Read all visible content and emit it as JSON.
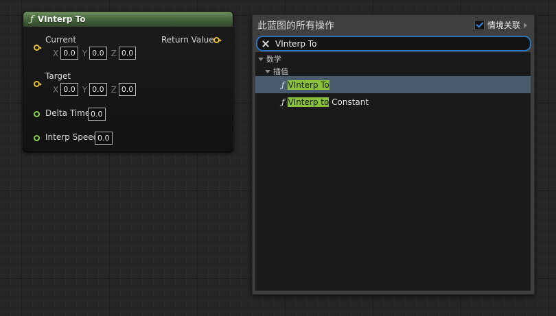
{
  "node": {
    "icon": "function-icon",
    "title": "VInterp To",
    "pins": {
      "current": {
        "label": "Current",
        "x_axis": "X",
        "x_value": "0.0",
        "y_axis": "Y",
        "y_value": "0.0",
        "z_axis": "Z",
        "z_value": "0.0"
      },
      "target": {
        "label": "Target",
        "x_axis": "X",
        "x_value": "0.0",
        "y_axis": "Y",
        "y_value": "0.0",
        "z_axis": "Z",
        "z_value": "0.0"
      },
      "delta_time": {
        "label": "Delta Time",
        "value": "0.0"
      },
      "interp_speed": {
        "label": "Interp Speed",
        "value": "0.0"
      },
      "return_value": {
        "label": "Return Value"
      }
    },
    "colors": {
      "vector_pin": "#e6c03a",
      "float_pin": "#8ad54b",
      "header": "#4a6a3f"
    }
  },
  "menu": {
    "title": "此蓝图的所有操作",
    "context_label": "情境关联",
    "context_checked": true,
    "search": {
      "value": "VInterp To"
    },
    "categories": [
      {
        "label": "数学"
      },
      {
        "label": "插值"
      }
    ],
    "items": [
      {
        "match": "VInterp To",
        "rest": "",
        "selected": true
      },
      {
        "match": "VInterp to",
        "rest": " Constant",
        "selected": false
      }
    ],
    "colors": {
      "highlight": "#88c23c",
      "selection": "#4a5b6e",
      "search_border": "#2d73b8",
      "checkmark": "#2f8ce0"
    }
  }
}
